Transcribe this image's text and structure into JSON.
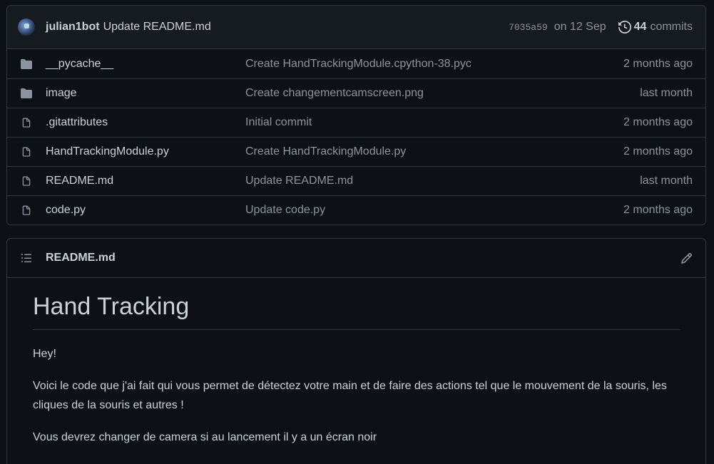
{
  "latest_commit": {
    "author": "julian1bot",
    "message": "Update README.md",
    "sha": "7035a59",
    "date": "on 12 Sep",
    "commits_count": "44",
    "commits_label": "commits"
  },
  "files": [
    {
      "type": "folder",
      "name": "__pycache__",
      "commit": "Create HandTrackingModule.cpython-38.pyc",
      "age": "2 months ago"
    },
    {
      "type": "folder",
      "name": "image",
      "commit": "Create changementcamscreen.png",
      "age": "last month"
    },
    {
      "type": "file",
      "name": ".gitattributes",
      "commit": "Initial commit",
      "age": "2 months ago"
    },
    {
      "type": "file",
      "name": "HandTrackingModule.py",
      "commit": "Create HandTrackingModule.py",
      "age": "2 months ago"
    },
    {
      "type": "file",
      "name": "README.md",
      "commit": "Update README.md",
      "age": "last month"
    },
    {
      "type": "file",
      "name": "code.py",
      "commit": "Update code.py",
      "age": "2 months ago"
    }
  ],
  "readme": {
    "filename": "README.md",
    "heading": "Hand Tracking",
    "paragraphs": [
      "Hey!",
      "Voici le code que j'ai fait qui vous permet de détectez votre main et de faire des actions tel que le mouvement de la souris, les cliques de la souris et autres !",
      "Vous devrez changer de camera si au lancement il y a un écran noir"
    ]
  },
  "colors": {
    "background": "#0d1117",
    "header_bg": "#161b22",
    "border": "#30363d",
    "text": "#c9d1d9",
    "muted": "#8b949e",
    "icon": "#8b949e"
  },
  "icons": {
    "folder": "folder-icon",
    "file": "file-icon",
    "history": "history-icon",
    "list": "list-icon",
    "edit": "pencil-icon"
  }
}
